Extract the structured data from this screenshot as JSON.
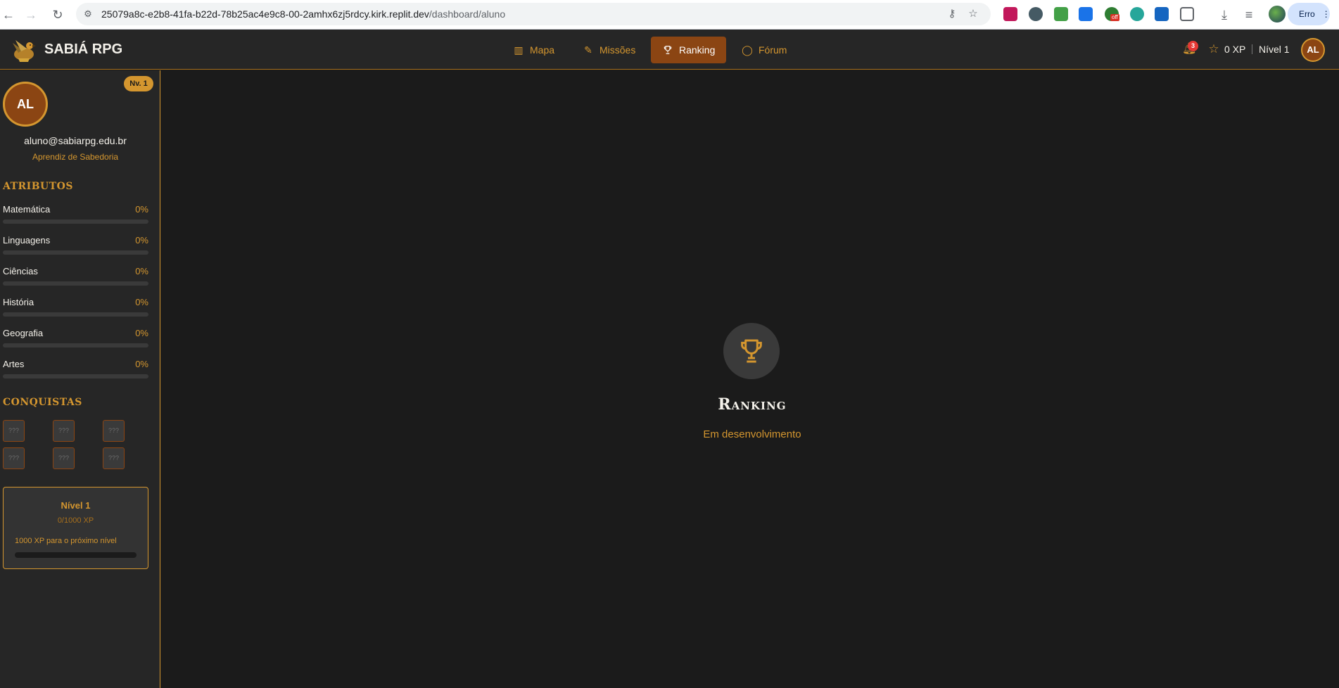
{
  "browser": {
    "url_host": "25079a8c-e2b8-41fa-b22d-78b25ac4e9c8-00-2amhx6zj5rdcy.kirk.replit.dev",
    "url_path": "/dashboard/aluno",
    "profile_button": "Erro",
    "extension_off_label": "off"
  },
  "header": {
    "brand": "SABIÁ RPG",
    "tabs": [
      {
        "label": "Mapa",
        "icon": "map-icon"
      },
      {
        "label": "Missões",
        "icon": "pen-icon"
      },
      {
        "label": "Ranking",
        "icon": "trophy-icon",
        "active": true
      },
      {
        "label": "Fórum",
        "icon": "chat-icon"
      }
    ],
    "notifications": "3",
    "xp": "0 XP",
    "level": "Nível 1",
    "avatar": "AL"
  },
  "sidebar": {
    "avatar": "AL",
    "level_badge": "Nv. 1",
    "email": "aluno@sabiarpg.edu.br",
    "rank_title": "Aprendiz de Sabedoria",
    "attributes_heading": "ATRIBUTOS",
    "attributes": [
      {
        "name": "Matemática",
        "pct": "0%",
        "value": 0
      },
      {
        "name": "Linguagens",
        "pct": "0%",
        "value": 0
      },
      {
        "name": "Ciências",
        "pct": "0%",
        "value": 0
      },
      {
        "name": "História",
        "pct": "0%",
        "value": 0
      },
      {
        "name": "Geografia",
        "pct": "0%",
        "value": 0
      },
      {
        "name": "Artes",
        "pct": "0%",
        "value": 0
      }
    ],
    "achievements_heading": "CONQUISTAS",
    "achievements": [
      "???",
      "???",
      "???",
      "???",
      "???",
      "???"
    ],
    "level_card": {
      "title": "Nível 1",
      "xp": "0/1000 XP",
      "next": "1000 XP para o próximo nível",
      "progress": 0
    }
  },
  "main": {
    "title": "Ranking",
    "subtitle": "Em desenvolvimento"
  },
  "colors": {
    "accent": "#d4962f",
    "active_tab": "#8b4513",
    "background": "#1b1b1b",
    "panel": "#262626"
  }
}
